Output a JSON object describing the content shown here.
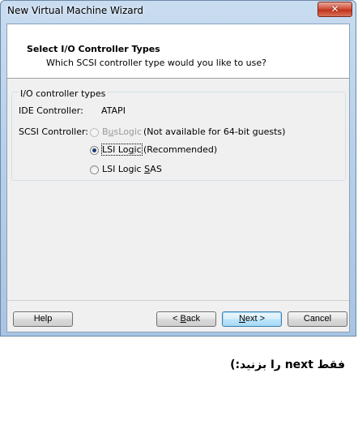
{
  "window": {
    "title": "New Virtual Machine Wizard",
    "close_glyph": "✕"
  },
  "header": {
    "title": "Select I/O Controller Types",
    "subtitle": "Which SCSI controller type would you like to use?"
  },
  "group": {
    "title": "I/O controller types",
    "ide_label": "IDE Controller:",
    "ide_value": "ATAPI",
    "scsi_label": "SCSI Controller:",
    "options": [
      {
        "label": "BusLogic",
        "note": "(Not available for 64-bit guests)",
        "selected": false,
        "enabled": false
      },
      {
        "label": "LSI Logic",
        "note": "(Recommended)",
        "selected": true,
        "enabled": true
      },
      {
        "label": "LSI Logic SAS",
        "note": "",
        "selected": false,
        "enabled": true
      }
    ]
  },
  "buttons": {
    "help": "Help",
    "back": "< Back",
    "next": "Next >",
    "cancel": "Cancel"
  },
  "note_text": "فقط next را بزنید:)",
  "colors": {
    "title_bar": "#b9d1ea",
    "close_button": "#c2331b",
    "dialog_bg": "#f0f0f0"
  }
}
